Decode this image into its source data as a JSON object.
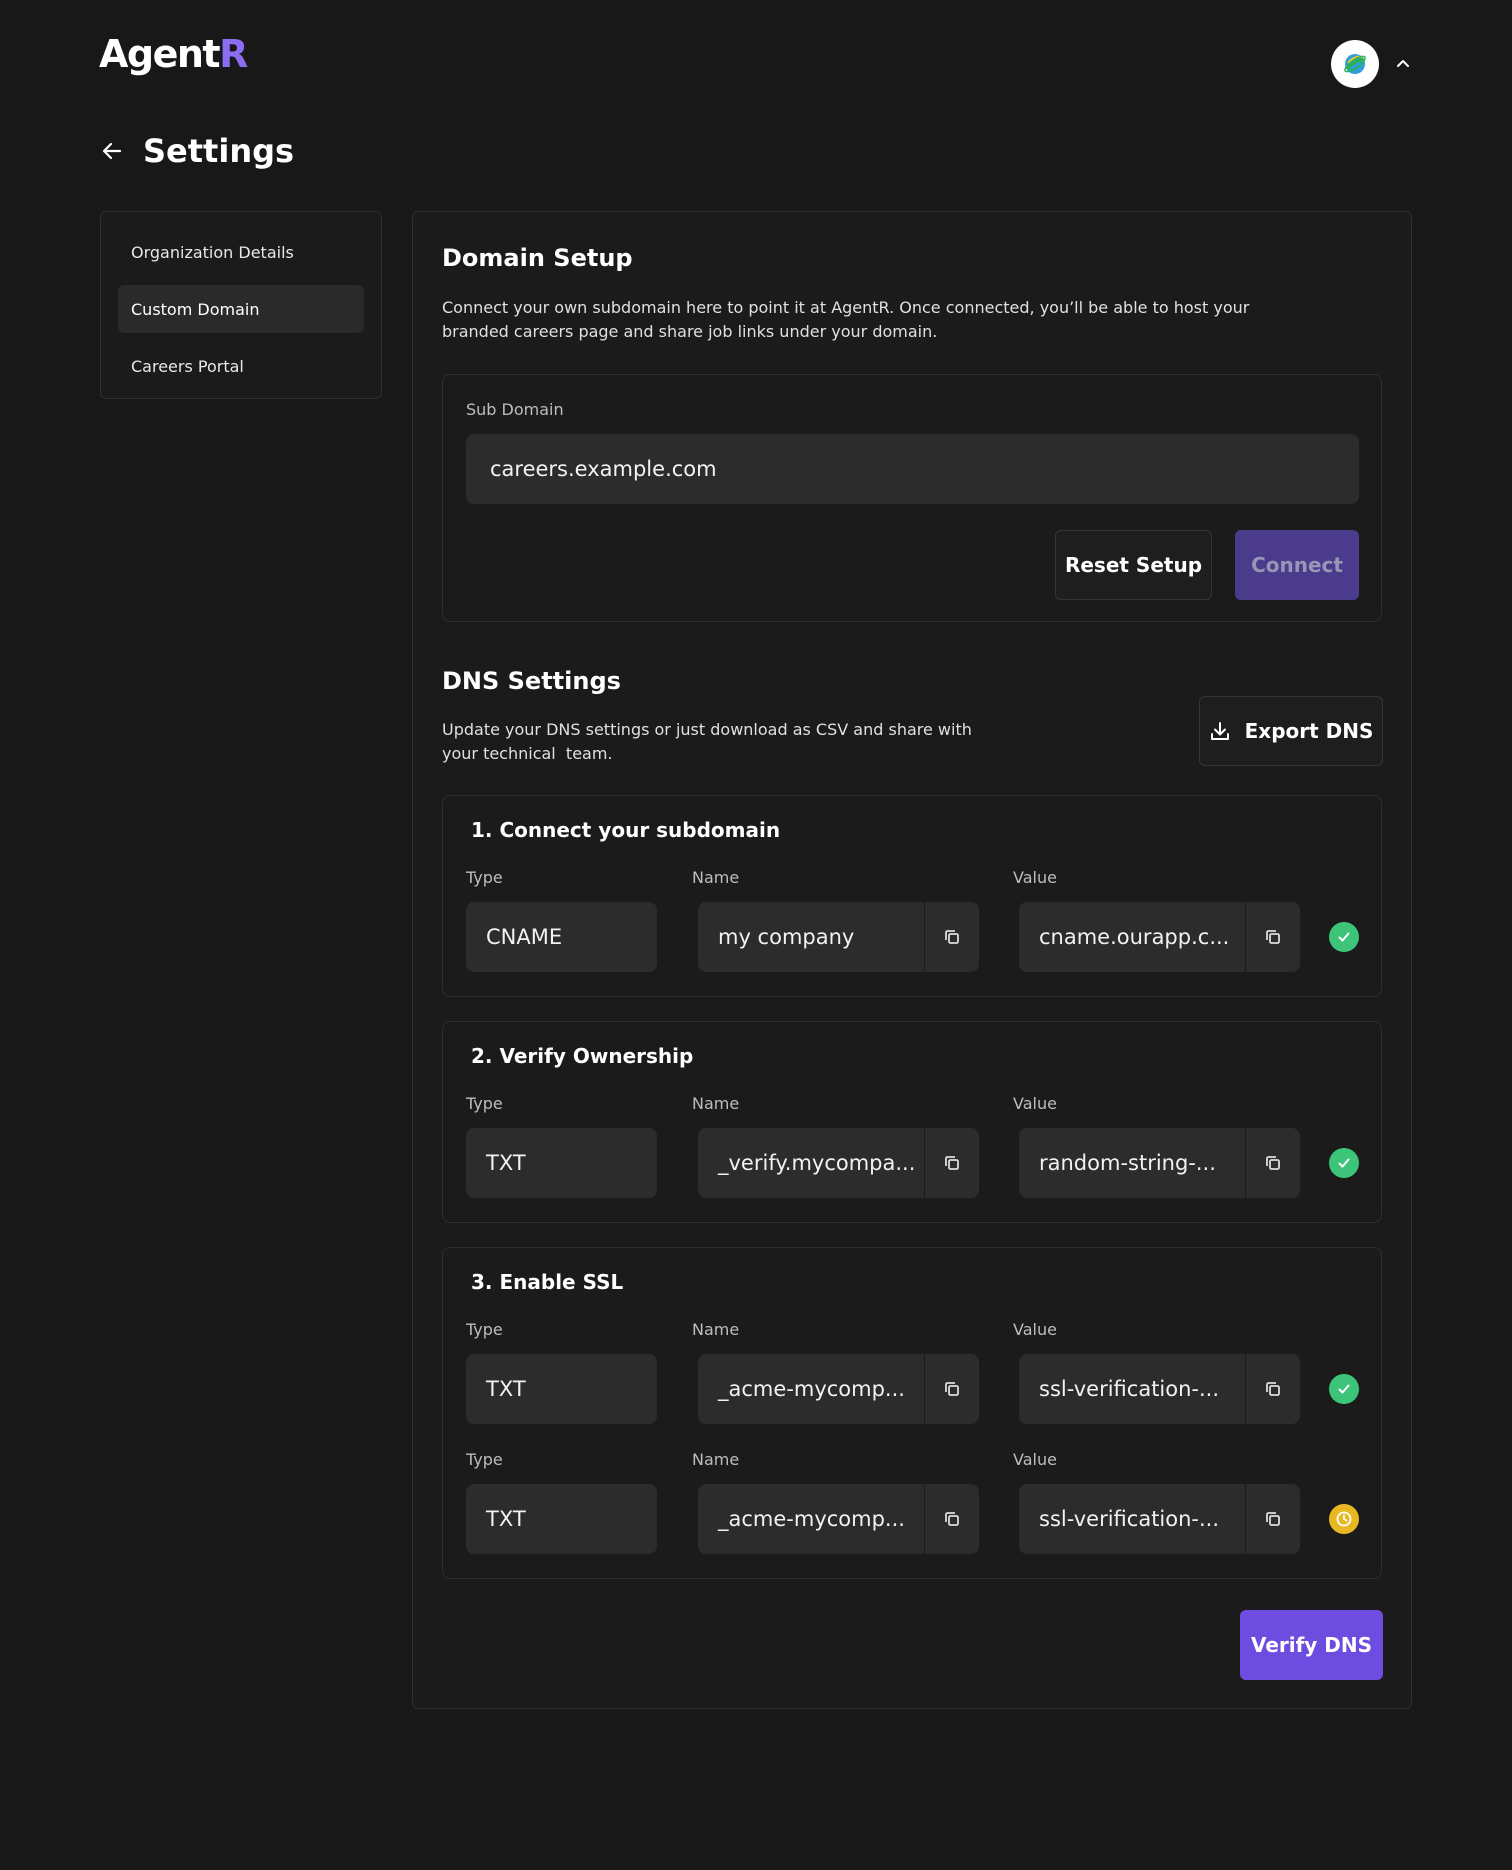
{
  "app": {
    "logo_main": "Agent",
    "logo_accent": "R"
  },
  "header": {
    "avatar_icon": "planet-logo-icon",
    "chevron_icon": "chevron-up-icon"
  },
  "page": {
    "title": "Settings",
    "back_icon": "arrow-left-icon"
  },
  "sidebar": {
    "items": [
      {
        "label": "Organization Details",
        "active": false
      },
      {
        "label": "Custom Domain",
        "active": true
      },
      {
        "label": "Careers Portal",
        "active": false
      }
    ]
  },
  "domain_setup": {
    "title": "Domain Setup",
    "description_line1": "Connect your own subdomain here to point it at AgentR. Once connected, you’ll be able to host your",
    "description_line2": "branded careers page and share job links under your domain.",
    "subdomain_label": "Sub Domain",
    "subdomain_value": "careers.example.com",
    "reset_label": "Reset Setup",
    "connect_label": "Connect"
  },
  "dns": {
    "title": "DNS Settings",
    "description_line1": "Update your DNS settings or just download as CSV and share with",
    "description_line2": "your technical  team.",
    "export_label": "Export DNS",
    "verify_label": "Verify DNS",
    "col_type": "Type",
    "col_name": "Name",
    "col_value": "Value",
    "steps": [
      {
        "title": "1. Connect your subdomain",
        "records": [
          {
            "type": "CNAME",
            "name": "my company",
            "value": "cname.ourapp.c...",
            "status": "verified"
          }
        ]
      },
      {
        "title": "2. Verify Ownership",
        "records": [
          {
            "type": "TXT",
            "name": "_verify.mycompa...",
            "value": "random-string-...",
            "status": "verified"
          }
        ]
      },
      {
        "title": "3. Enable SSL",
        "records": [
          {
            "type": "TXT",
            "name": "_acme-mycomp...",
            "value": "ssl-verification-...",
            "status": "verified"
          },
          {
            "type": "TXT",
            "name": "_acme-mycomp...",
            "value": "ssl-verification-...",
            "status": "pending"
          }
        ]
      }
    ]
  },
  "colors": {
    "accent": "#6d4de0",
    "success": "#3cc478",
    "pending": "#e8b820"
  }
}
